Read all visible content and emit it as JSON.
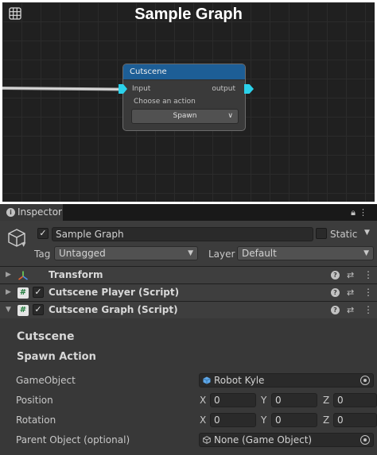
{
  "graph": {
    "title": "Sample Graph",
    "node": {
      "title": "Cutscene",
      "input_label": "Input",
      "output_label": "output",
      "choose_label": "Choose an action",
      "action_value": "Spawn"
    }
  },
  "inspector": {
    "tab_label": "Inspector",
    "object": {
      "active": true,
      "name": "Sample Graph",
      "static_label": "Static",
      "static": false,
      "tag_label": "Tag",
      "tag_value": "Untagged",
      "layer_label": "Layer",
      "layer_value": "Default"
    },
    "components": [
      {
        "title": "Transform",
        "has_checkbox": false
      },
      {
        "title": "Cutscene Player (Script)",
        "has_checkbox": true,
        "enabled": true
      },
      {
        "title": "Cutscene Graph (Script)",
        "has_checkbox": true,
        "enabled": true,
        "expanded": true
      }
    ],
    "cutscene": {
      "section_title": "Cutscene",
      "subsection_title": "Spawn Action",
      "gameobject_label": "GameObject",
      "gameobject_value": "Robot Kyle",
      "position_label": "Position",
      "position": {
        "x": "0",
        "y": "0",
        "z": "0"
      },
      "rotation_label": "Rotation",
      "rotation": {
        "x": "0",
        "y": "0",
        "z": "0"
      },
      "parent_label": "Parent Object (optional)",
      "parent_value": "None (Game Object)",
      "axis_labels": {
        "x": "X",
        "y": "Y",
        "z": "Z"
      }
    }
  },
  "colors": {
    "port": "#2bd1ea",
    "node_header": "#1d5e96",
    "inspector_bg": "#383838",
    "graph_bg": "#202020"
  }
}
